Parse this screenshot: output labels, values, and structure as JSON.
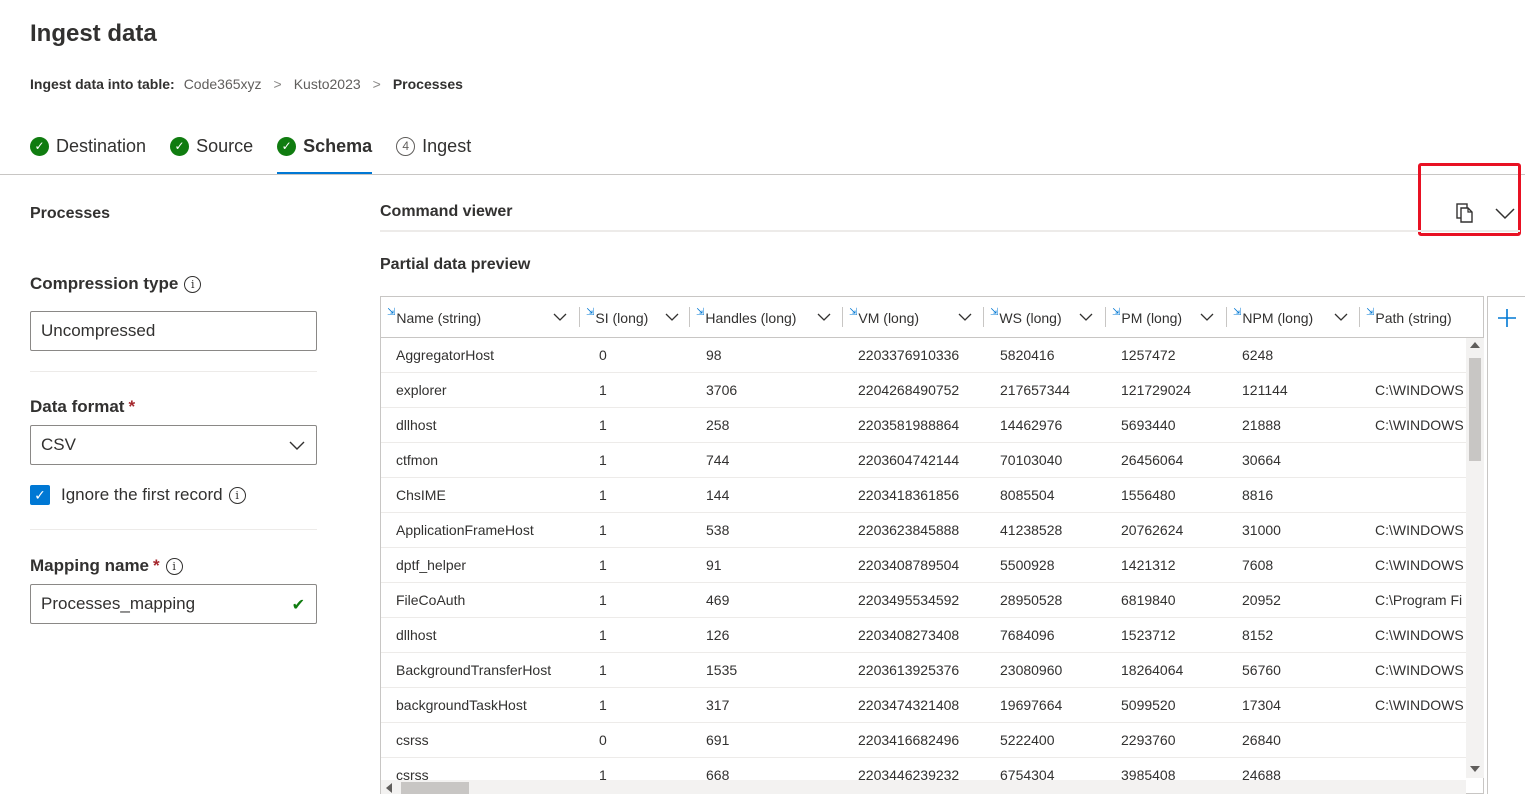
{
  "page": {
    "title": "Ingest data"
  },
  "breadcrumb": {
    "label": "Ingest data into table:",
    "items": [
      "Code365xyz",
      "Kusto2023"
    ],
    "current": "Processes",
    "separator": ">"
  },
  "steps": [
    {
      "label": "Destination",
      "state": "done"
    },
    {
      "label": "Source",
      "state": "done"
    },
    {
      "label": "Schema",
      "state": "active"
    },
    {
      "label": "Ingest",
      "state": "pending",
      "number": "4"
    }
  ],
  "left": {
    "table_name": "Processes",
    "compression": {
      "label": "Compression type",
      "value": "Uncompressed"
    },
    "data_format": {
      "label": "Data format",
      "required": "*",
      "value": "CSV"
    },
    "ignore_first": {
      "label": "Ignore the first record",
      "checked": true
    },
    "mapping": {
      "label": "Mapping name",
      "required": "*",
      "value": "Processes_mapping"
    }
  },
  "command_viewer": {
    "title": "Command viewer",
    "copy_icon": "copy-icon",
    "expand_icon": "chevron-down-icon"
  },
  "preview": {
    "title": "Partial data preview",
    "columns": [
      "Name (string)",
      "SI (long)",
      "Handles (long)",
      "VM (long)",
      "WS (long)",
      "PM (long)",
      "NPM (long)",
      "Path (string)"
    ],
    "rows": [
      [
        "AggregatorHost",
        "0",
        "98",
        "2203376910336",
        "5820416",
        "1257472",
        "6248",
        ""
      ],
      [
        "explorer",
        "1",
        "3706",
        "2204268490752",
        "217657344",
        "121729024",
        "121144",
        "C:\\WINDOWS"
      ],
      [
        "dllhost",
        "1",
        "258",
        "2203581988864",
        "14462976",
        "5693440",
        "21888",
        "C:\\WINDOWS"
      ],
      [
        "ctfmon",
        "1",
        "744",
        "2203604742144",
        "70103040",
        "26456064",
        "30664",
        ""
      ],
      [
        "ChsIME",
        "1",
        "144",
        "2203418361856",
        "8085504",
        "1556480",
        "8816",
        ""
      ],
      [
        "ApplicationFrameHost",
        "1",
        "538",
        "2203623845888",
        "41238528",
        "20762624",
        "31000",
        "C:\\WINDOWS"
      ],
      [
        "dptf_helper",
        "1",
        "91",
        "2203408789504",
        "5500928",
        "1421312",
        "7608",
        "C:\\WINDOWS"
      ],
      [
        "FileCoAuth",
        "1",
        "469",
        "2203495534592",
        "28950528",
        "6819840",
        "20952",
        "C:\\Program Fi"
      ],
      [
        "dllhost",
        "1",
        "126",
        "2203408273408",
        "7684096",
        "1523712",
        "8152",
        "C:\\WINDOWS"
      ],
      [
        "BackgroundTransferHost",
        "1",
        "1535",
        "2203613925376",
        "23080960",
        "18264064",
        "56760",
        "C:\\WINDOWS"
      ],
      [
        "backgroundTaskHost",
        "1",
        "317",
        "2203474321408",
        "19697664",
        "5099520",
        "17304",
        "C:\\WINDOWS"
      ],
      [
        "csrss",
        "0",
        "691",
        "2203416682496",
        "5222400",
        "2293760",
        "26840",
        ""
      ],
      [
        "csrss",
        "1",
        "668",
        "2203446239232",
        "6754304",
        "3985408",
        "24688",
        ""
      ]
    ]
  },
  "colors": {
    "accent": "#0078d4",
    "success": "#107c10",
    "highlight": "#e81123",
    "required": "#a4262c"
  }
}
